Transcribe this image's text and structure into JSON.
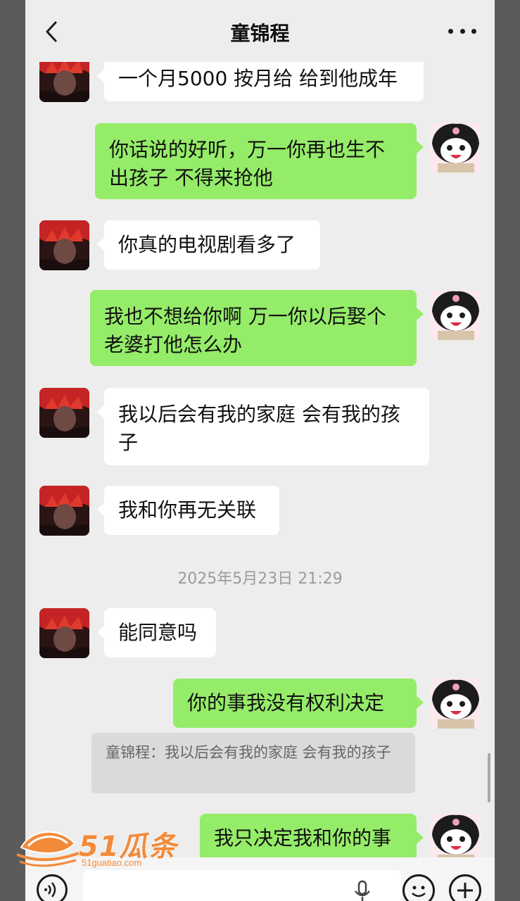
{
  "header": {
    "title": "童锦程"
  },
  "messages": [
    {
      "text": "一个月5000 按月给 给到他成年"
    },
    {
      "text": "你话说的好听，万一你再也生不出孩子 不得来抢他"
    },
    {
      "text": "你真的电视剧看多了"
    },
    {
      "text": "我也不想给你啊 万一你以后娶个老婆打他怎么办"
    },
    {
      "text": "我以后会有我的家庭 会有我的孩子"
    },
    {
      "text": "我和你再无关联"
    },
    {
      "text": "能同意吗"
    },
    {
      "text": "你的事我没有权利决定"
    },
    {
      "text": "我只决定我和你的事"
    }
  ],
  "timestamp": "2025年5月23日 21:29",
  "quote": {
    "text": "童锦程：我以后会有我的家庭 会有我的孩子"
  },
  "watermark": {
    "brand": "51瓜条",
    "url": "51guatiao.com"
  },
  "colors": {
    "outgoing_bubble": "#95ec69",
    "incoming_bubble": "#ffffff",
    "background": "#ededed",
    "watermark": "#f28a3a"
  },
  "icons": [
    "back-chevron-icon",
    "more-dots-icon",
    "voice-icon",
    "mic-icon",
    "emoji-icon",
    "plus-icon"
  ]
}
